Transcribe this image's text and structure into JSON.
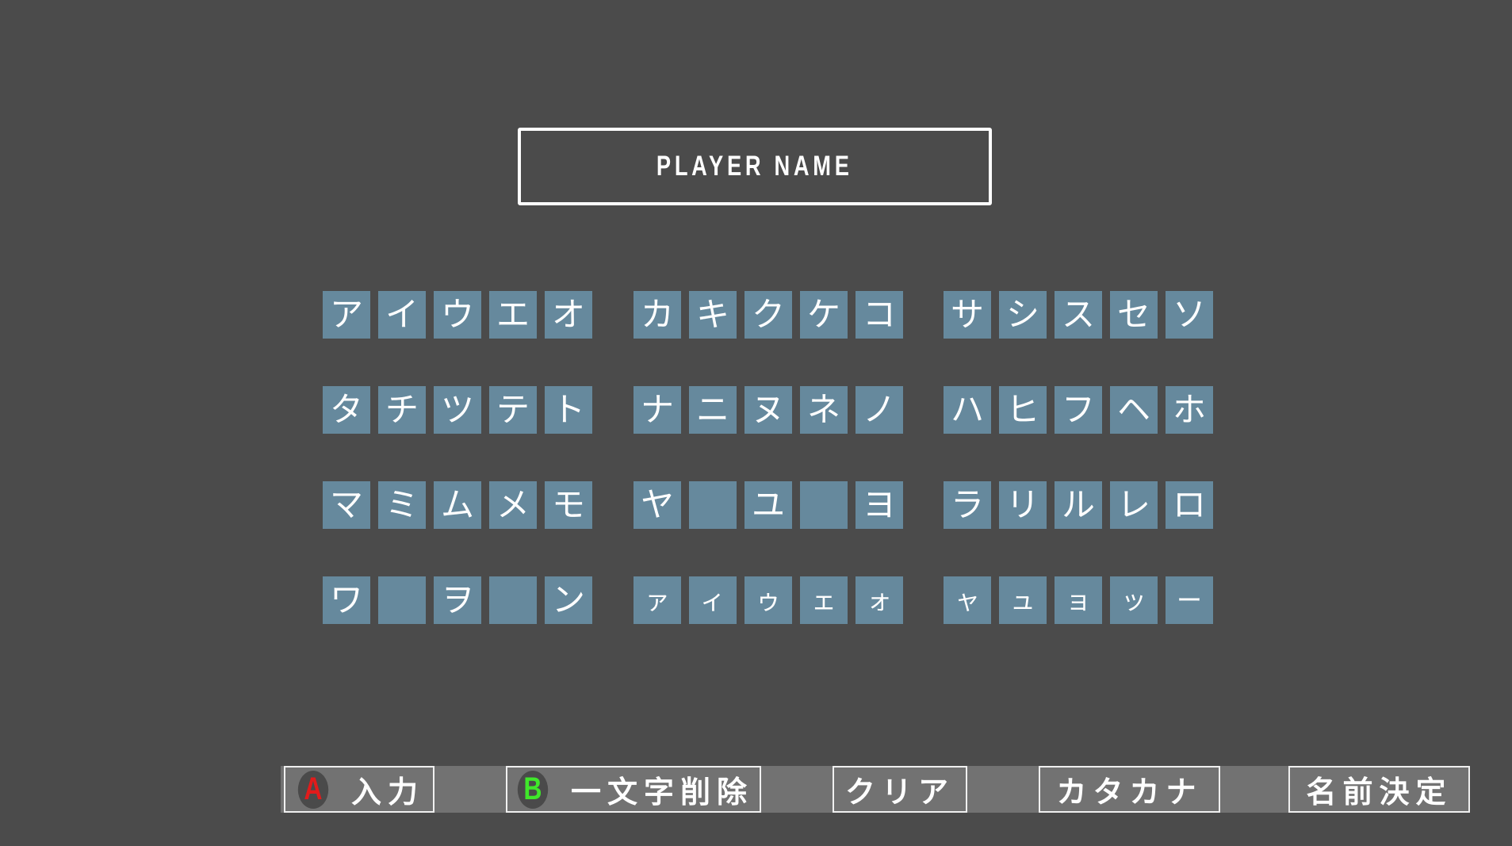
{
  "header": {
    "title": "PLAYER NAME"
  },
  "keyboard": {
    "groups": [
      [
        [
          "ア",
          "イ",
          "ウ",
          "エ",
          "オ"
        ],
        [
          "タ",
          "チ",
          "ツ",
          "テ",
          "ト"
        ],
        [
          "マ",
          "ミ",
          "ム",
          "メ",
          "モ"
        ],
        [
          "ワ",
          "",
          "ヲ",
          "",
          "ン"
        ]
      ],
      [
        [
          "カ",
          "キ",
          "ク",
          "ケ",
          "コ"
        ],
        [
          "ナ",
          "ニ",
          "ヌ",
          "ネ",
          "ノ"
        ],
        [
          "ヤ",
          "",
          "ユ",
          "",
          "ヨ"
        ],
        [
          "ァ",
          "ィ",
          "ゥ",
          "ェ",
          "ォ"
        ]
      ],
      [
        [
          "サ",
          "シ",
          "ス",
          "セ",
          "ソ"
        ],
        [
          "ハ",
          "ヒ",
          "フ",
          "ヘ",
          "ホ"
        ],
        [
          "ラ",
          "リ",
          "ル",
          "レ",
          "ロ"
        ],
        [
          "ャ",
          "ュ",
          "ョ",
          "ッ",
          "ー"
        ]
      ]
    ]
  },
  "actions": {
    "input": {
      "badge": "A",
      "label": "入力",
      "badge_color": "#e11b1b"
    },
    "delete": {
      "badge": "B",
      "label": "一文字削除",
      "badge_color": "#3fe82a"
    },
    "clear": {
      "label": "クリア"
    },
    "katakana": {
      "label": "カタカナ"
    },
    "confirm": {
      "label": "名前決定"
    }
  },
  "colors": {
    "background": "#4b4b4b",
    "key": "#66899d",
    "bar": "#727272"
  }
}
